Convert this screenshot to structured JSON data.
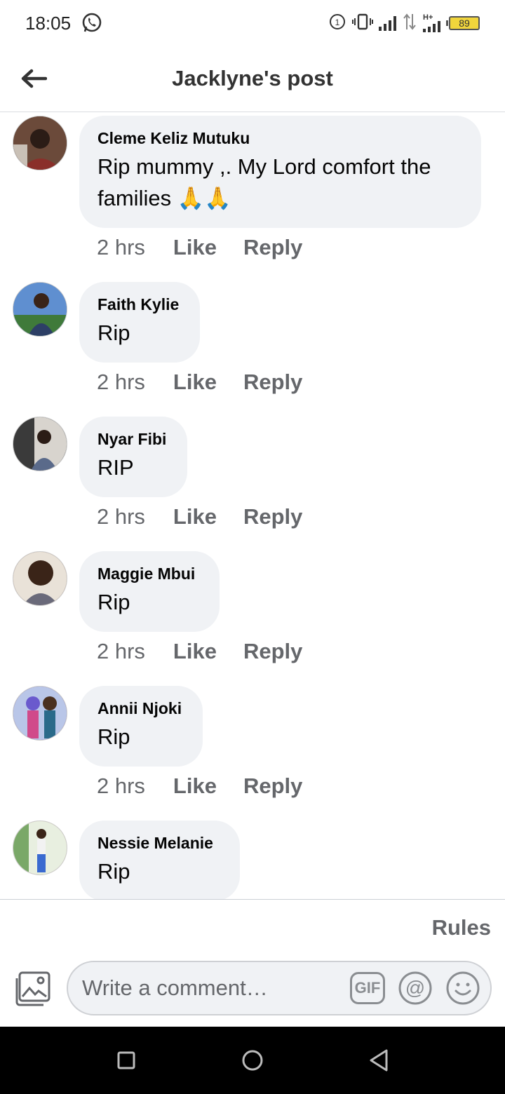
{
  "status_bar": {
    "time": "18:05",
    "battery": "89",
    "network": "H+"
  },
  "header": {
    "title": "Jacklyne's post"
  },
  "comments": [
    {
      "author": "Cleme Keliz Mutuku",
      "text": "Rip mummy ,. My Lord comfort the families 🙏🙏",
      "time": "2 hrs",
      "like": "Like",
      "reply": "Reply",
      "avatar_color": "#5a3b2e"
    },
    {
      "author": "Faith Kylie",
      "text": "Rip",
      "time": "2 hrs",
      "like": "Like",
      "reply": "Reply",
      "avatar_color": "#3d6fb0"
    },
    {
      "author": "Nyar Fibi",
      "text": "RIP",
      "time": "2 hrs",
      "like": "Like",
      "reply": "Reply",
      "avatar_color": "#4a4a4a"
    },
    {
      "author": "Maggie Mbui",
      "text": "Rip",
      "time": "2 hrs",
      "like": "Like",
      "reply": "Reply",
      "avatar_color": "#b08a70"
    },
    {
      "author": "Annii Njoki",
      "text": "Rip",
      "time": "2 hrs",
      "like": "Like",
      "reply": "Reply",
      "avatar_color": "#7a5fa8"
    },
    {
      "author": "Nessie Melanie",
      "text": "Rip",
      "time": "",
      "like": "",
      "reply": "",
      "avatar_color": "#c9b89a"
    }
  ],
  "composer": {
    "rules_label": "Rules",
    "placeholder": "Write a comment…",
    "gif_label": "GIF"
  },
  "colors": {
    "bubble": "#f0f2f5",
    "secondary_text": "#65676b",
    "navbar": "#000000"
  }
}
